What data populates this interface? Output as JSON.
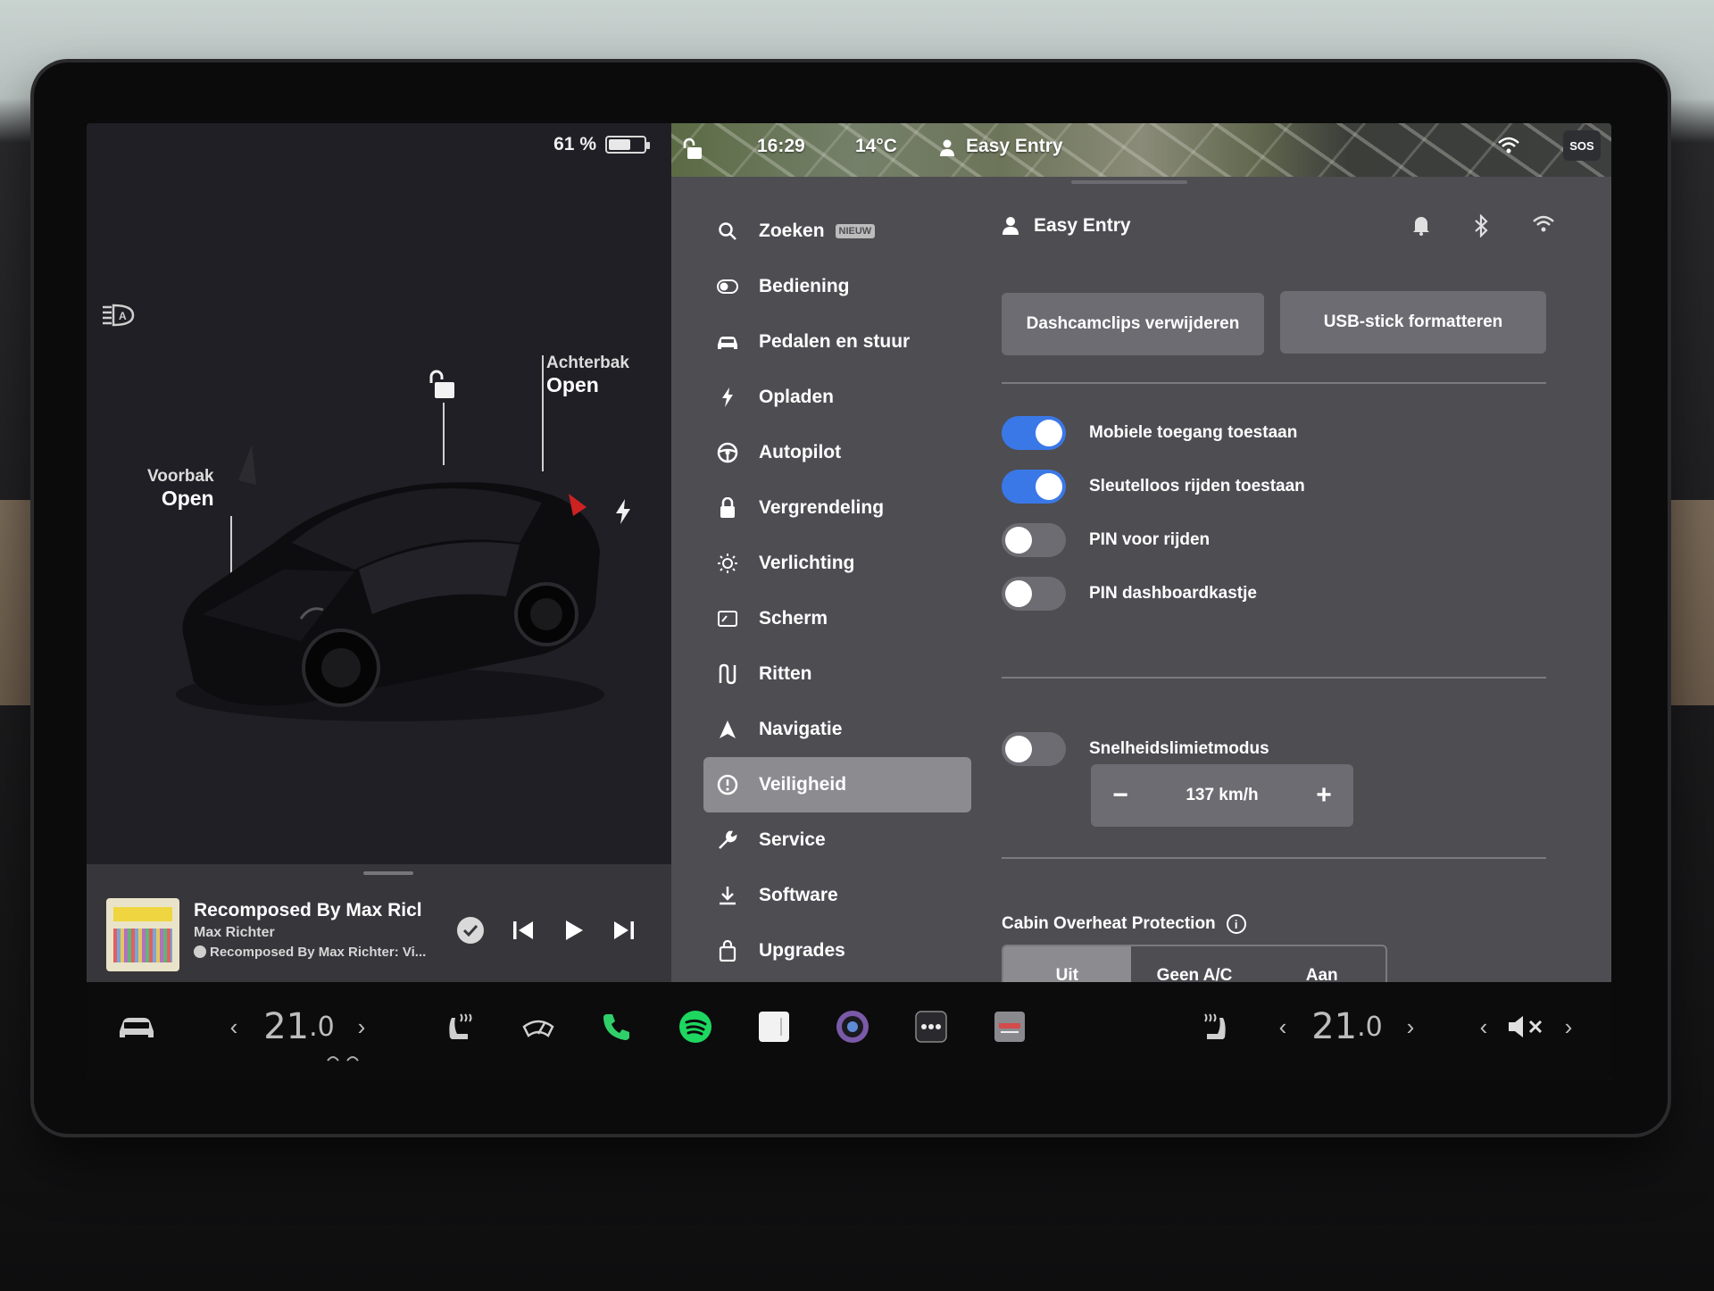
{
  "car": {
    "battery_percent": "61 %",
    "battery_level": 0.61,
    "frunk": {
      "label": "Voorbak",
      "state": "Open"
    },
    "trunk": {
      "label": "Achterbak",
      "state": "Open"
    }
  },
  "media": {
    "track": "Recomposed By Max Ricl",
    "artist": "Max Richter",
    "album": "Recomposed By Max Richter: Vi..."
  },
  "status_bar": {
    "time": "16:29",
    "temperature": "14°C",
    "profile": "Easy Entry",
    "sos": "SOS"
  },
  "menu": {
    "items": [
      {
        "label": "Zoeken",
        "icon": "search-icon",
        "badge": "NIEUW"
      },
      {
        "label": "Bediening",
        "icon": "toggle-icon"
      },
      {
        "label": "Pedalen en stuur",
        "icon": "car-icon"
      },
      {
        "label": "Opladen",
        "icon": "bolt-icon"
      },
      {
        "label": "Autopilot",
        "icon": "steering-wheel-icon"
      },
      {
        "label": "Vergrendeling",
        "icon": "lock-icon"
      },
      {
        "label": "Verlichting",
        "icon": "sun-icon"
      },
      {
        "label": "Scherm",
        "icon": "display-icon"
      },
      {
        "label": "Ritten",
        "icon": "trips-icon"
      },
      {
        "label": "Navigatie",
        "icon": "navigation-icon"
      },
      {
        "label": "Veiligheid",
        "icon": "safety-icon",
        "active": true
      },
      {
        "label": "Service",
        "icon": "wrench-icon"
      },
      {
        "label": "Software",
        "icon": "download-icon"
      },
      {
        "label": "Upgrades",
        "icon": "bag-icon"
      }
    ]
  },
  "safety": {
    "profile_name": "Easy Entry",
    "buttons": {
      "delete_dashcam": "Dashcamclips verwijderen",
      "format_usb": "USB-stick formatteren"
    },
    "toggles": [
      {
        "label": "Mobiele toegang toestaan",
        "on": true
      },
      {
        "label": "Sleutelloos rijden toestaan",
        "on": true
      },
      {
        "label": "PIN voor rijden",
        "on": false
      },
      {
        "label": "PIN dashboardkastje",
        "on": false
      }
    ],
    "speed_limit": {
      "label": "Snelheidslimietmodus",
      "on": false,
      "value": "137 km/h",
      "minus": "−",
      "plus": "+"
    },
    "cabin_overheat": {
      "title": "Cabin Overheat Protection",
      "options": [
        "Uit",
        "Geen A/C",
        "Aan"
      ],
      "selected": "Uit"
    }
  },
  "dock": {
    "driver_temp": {
      "whole": "21",
      "decimal": ".0"
    },
    "passenger_temp": {
      "whole": "21",
      "decimal": ".0"
    },
    "apps": [
      "car-icon",
      "seat-heater-icon",
      "wiper-icon",
      "phone-icon",
      "spotify-icon",
      "notes-icon",
      "camera-icon",
      "more-icon",
      "toybox-icon",
      "seat-heater-icon",
      "mute-icon"
    ]
  },
  "colors": {
    "accent": "#3a78e8",
    "phone": "#2fd06a",
    "spotify": "#1ed760"
  }
}
